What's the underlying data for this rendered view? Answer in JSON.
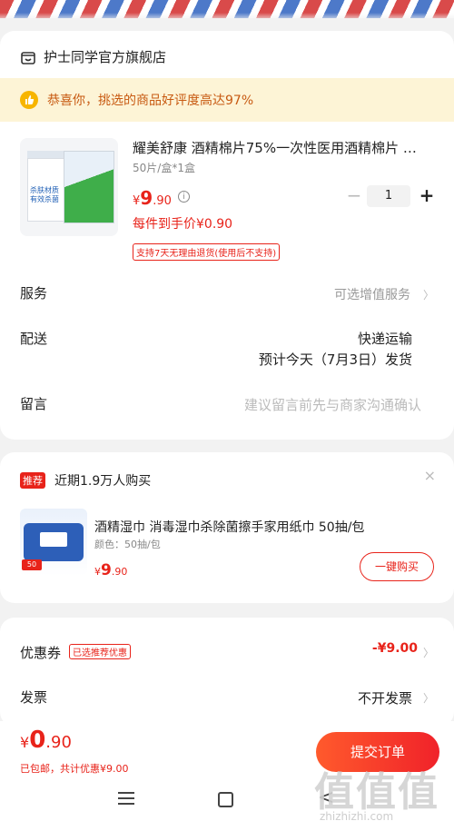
{
  "shop": {
    "name": "护士同学官方旗舰店"
  },
  "banner": {
    "text": "恭喜你，挑选的商品好评度高达97%"
  },
  "product": {
    "title": "耀美舒康 酒精棉片75%一次性医用酒精棉片 …",
    "spec": "50片/盒*1盒",
    "price_currency": "¥",
    "price_int": "9",
    "price_dec": ".90",
    "info_icon": "i",
    "unit_price": "每件到手价¥0.90",
    "return_tag": "支持7天无理由退货(使用后不支持)",
    "quantity": "1",
    "minus": "−",
    "plus": "+",
    "box_text": "杀肤材质\n有效杀菌"
  },
  "rows": {
    "service_label": "服务",
    "service_value": "可选增值服务",
    "delivery_label": "配送",
    "delivery_method": "快递运输",
    "delivery_eta": "预计今天（7月3日）发货",
    "note_label": "留言",
    "note_placeholder": "建议留言前先与商家沟通确认",
    "chevron": "〉"
  },
  "recommend": {
    "badge": "推荐",
    "title": "近期1.9万人购买",
    "close": "×",
    "item_name": "酒精湿巾 消毒湿巾杀除菌擦手家用纸巾 50抽/包",
    "item_spec": "颜色：50抽/包",
    "price_currency": "¥",
    "price_int": "9",
    "price_dec": ".90",
    "buy_label": "一键购买",
    "pack_badge": "50"
  },
  "coupon": {
    "label": "优惠券",
    "tag": "已选推荐优惠",
    "value": "-¥9.00",
    "invoice_label": "发票",
    "invoice_value": "不开发票"
  },
  "footer": {
    "total_currency": "¥",
    "total_int": "0",
    "total_dec": ".90",
    "note": "已包邮，共计优惠¥9.00",
    "submit_label": "提交订单"
  },
  "watermark": {
    "big": "值值值",
    "small": "zhizhizhi.com"
  },
  "colors": {
    "accent": "#e8231a",
    "banner_bg": "#fdf4d6",
    "banner_text": "#c85a12"
  }
}
